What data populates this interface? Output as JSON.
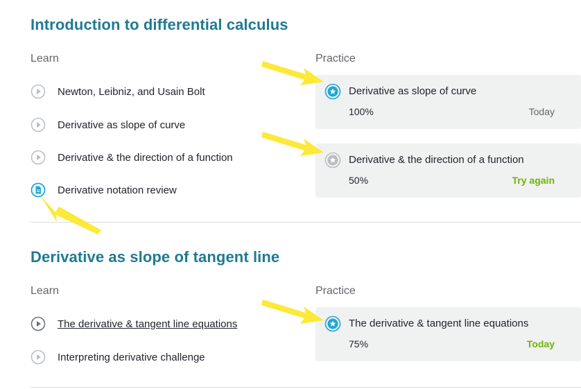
{
  "sections": [
    {
      "title": "Introduction to differential calculus",
      "learn_label": "Learn",
      "practice_label": "Practice",
      "learn_items": [
        {
          "label": "Newton, Leibniz, and Usain Bolt",
          "icon": "play-icon"
        },
        {
          "label": "Derivative as slope of curve",
          "icon": "play-icon"
        },
        {
          "label": "Derivative & the direction of a function",
          "icon": "play-icon"
        },
        {
          "label": "Derivative notation review",
          "icon": "article-icon"
        }
      ],
      "practice_items": [
        {
          "title": "Derivative as slope of curve",
          "percent": "100%",
          "status": "Today",
          "icon": "star-badge-blue-icon"
        },
        {
          "title": "Derivative & the direction of a function",
          "percent": "50%",
          "status": "Try again",
          "icon": "star-badge-gray-icon"
        }
      ]
    },
    {
      "title": "Derivative as slope of tangent line",
      "learn_label": "Learn",
      "practice_label": "Practice",
      "learn_items": [
        {
          "label": "The derivative & tangent line equations",
          "icon": "play-icon"
        },
        {
          "label": "Interpreting derivative challenge",
          "icon": "play-icon"
        }
      ],
      "practice_items": [
        {
          "title": "The derivative & tangent line equations",
          "percent": "75%",
          "status": "Today",
          "icon": "star-badge-blue-icon"
        }
      ]
    }
  ],
  "colors": {
    "section_title": "#1f7a91",
    "accent_blue": "#1ea7d4",
    "success_green": "#71b307",
    "card_bg": "#f0f1f1",
    "annotation_arrow": "#fce938"
  }
}
